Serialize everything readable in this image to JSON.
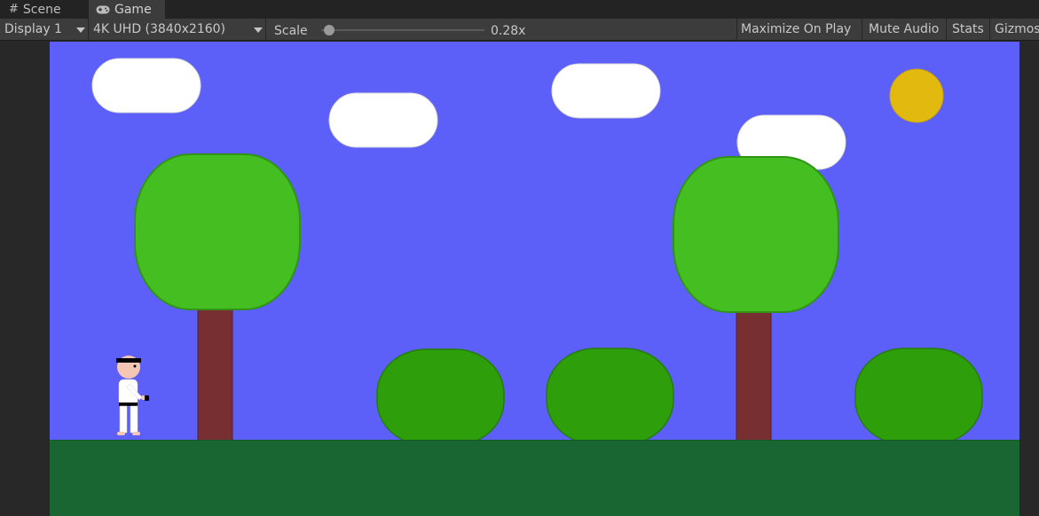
{
  "tabs": [
    {
      "label": "Scene",
      "icon": "grid-icon"
    },
    {
      "label": "Game",
      "icon": "gamepad-icon"
    }
  ],
  "toolbar": {
    "display": "Display 1",
    "resolution": "4K UHD (3840x2160)",
    "scale_label": "Scale",
    "scale_value": "0.28x",
    "maximize": "Maximize On Play",
    "mute": "Mute Audio",
    "stats": "Stats",
    "gizmos": "Gizmos"
  },
  "colors": {
    "sky": "#5c5ff8",
    "ground": "#1a6632",
    "cloud": "#ffffff",
    "sun": "#e2b90f",
    "tree_crown": "#44be20",
    "tree_trunk": "#772f31",
    "bush": "#2e9f0b",
    "player_gi": "#ffffff",
    "player_skin": "#f5c6b3",
    "belt": "#000000"
  }
}
